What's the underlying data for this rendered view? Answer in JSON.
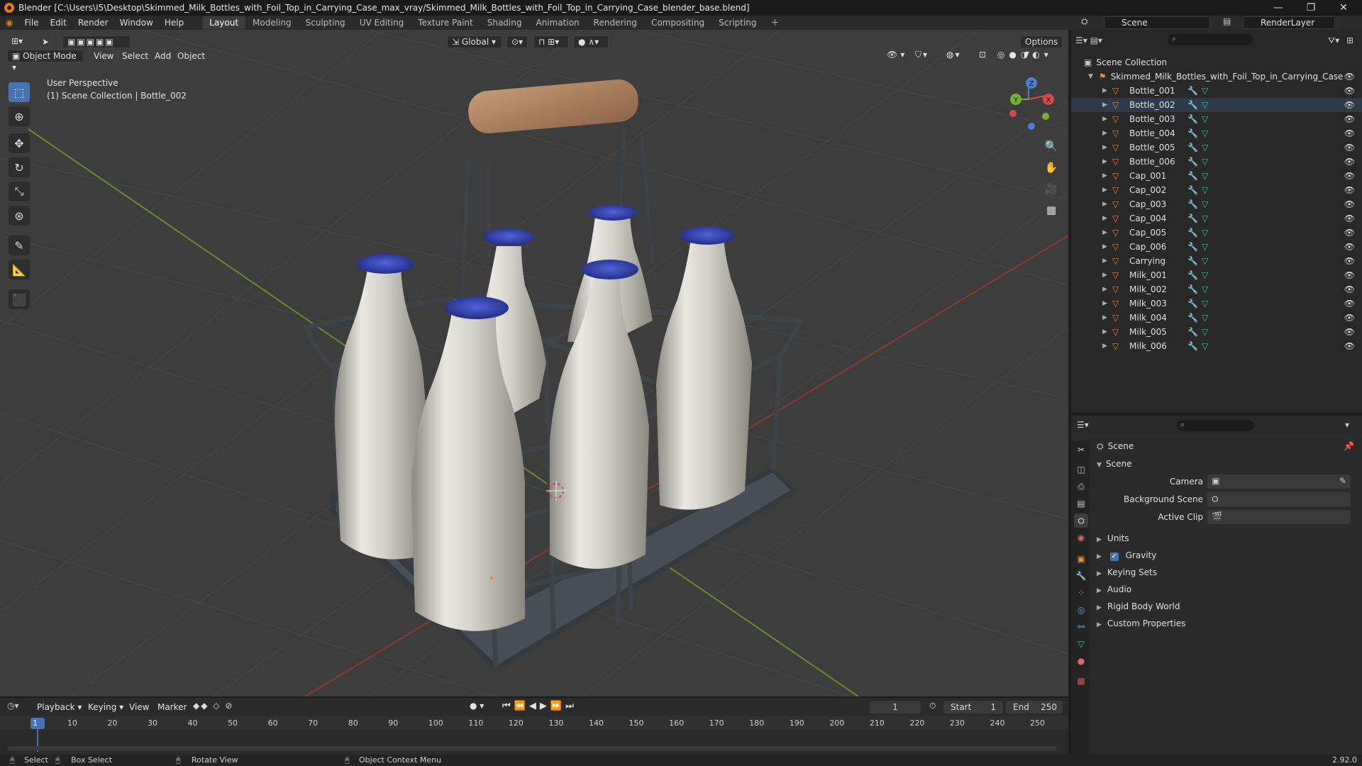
{
  "titlebar": {
    "title": "Blender [C:\\Users\\I5\\Desktop\\Skimmed_Milk_Bottles_with_Foil_Top_in_Carrying_Case_max_vray/Skimmed_Milk_Bottles_with_Foil_Top_in_Carrying_Case_blender_base.blend]",
    "minimize": "—",
    "maximize": "❐",
    "close": "✕"
  },
  "menu": [
    "File",
    "Edit",
    "Render",
    "Window",
    "Help"
  ],
  "workspaces": [
    "Layout",
    "Modeling",
    "Sculpting",
    "UV Editing",
    "Texture Paint",
    "Shading",
    "Animation",
    "Rendering",
    "Compositing",
    "Scripting"
  ],
  "active_workspace": "Layout",
  "scene_selector": "Scene",
  "view_layer_selector": "RenderLayer",
  "viewport": {
    "transform_orientation": "Global",
    "options_label": "Options",
    "mode": "Object Mode",
    "menus": [
      "View",
      "Select",
      "Add",
      "Object"
    ],
    "overlay_line1": "User Perspective",
    "overlay_line2": "(1) Scene Collection | Bottle_002",
    "gizmo": {
      "z": "Z",
      "y": "Y",
      "x": "X"
    }
  },
  "outliner": {
    "root": "Scene Collection",
    "collection": "Skimmed_Milk_Bottles_with_Foil_Top_in_Carrying_Case",
    "items": [
      {
        "name": "Bottle_001",
        "selected": false
      },
      {
        "name": "Bottle_002",
        "selected": true
      },
      {
        "name": "Bottle_003",
        "selected": false
      },
      {
        "name": "Bottle_004",
        "selected": false
      },
      {
        "name": "Bottle_005",
        "selected": false
      },
      {
        "name": "Bottle_006",
        "selected": false
      },
      {
        "name": "Cap_001",
        "selected": false
      },
      {
        "name": "Cap_002",
        "selected": false
      },
      {
        "name": "Cap_003",
        "selected": false
      },
      {
        "name": "Cap_004",
        "selected": false
      },
      {
        "name": "Cap_005",
        "selected": false
      },
      {
        "name": "Cap_006",
        "selected": false
      },
      {
        "name": "Carrying",
        "selected": false
      },
      {
        "name": "Milk_001",
        "selected": false
      },
      {
        "name": "Milk_002",
        "selected": false
      },
      {
        "name": "Milk_003",
        "selected": false
      },
      {
        "name": "Milk_004",
        "selected": false
      },
      {
        "name": "Milk_005",
        "selected": false
      },
      {
        "name": "Milk_006",
        "selected": false
      }
    ]
  },
  "properties": {
    "context": "Scene",
    "panel": "Scene",
    "camera_label": "Camera",
    "background_scene_label": "Background Scene",
    "active_clip_label": "Active Clip",
    "sections": [
      "Units",
      "Gravity",
      "Keying Sets",
      "Audio",
      "Rigid Body World",
      "Custom Properties"
    ],
    "gravity_checked": true
  },
  "timeline": {
    "menus": [
      "Playback",
      "Keying",
      "View",
      "Marker"
    ],
    "current_frame": "1",
    "start_label": "Start",
    "start": "1",
    "end_label": "End",
    "end": "250",
    "ticks": [
      "1",
      "10",
      "20",
      "30",
      "40",
      "50",
      "60",
      "70",
      "80",
      "90",
      "100",
      "110",
      "120",
      "130",
      "140",
      "150",
      "160",
      "170",
      "180",
      "190",
      "200",
      "210",
      "220",
      "230",
      "240",
      "250"
    ]
  },
  "statusbar": {
    "select": "Select",
    "box_select": "Box Select",
    "rotate_view": "Rotate View",
    "context_menu": "Object Context Menu",
    "version": "2.92.0"
  },
  "colors": {
    "accent": "#4772b3",
    "object_orange": "#e08b3a",
    "mesh_green": "#3fc6a0",
    "axis_red": "#9b3a3a",
    "axis_green": "#7a9a2a"
  }
}
